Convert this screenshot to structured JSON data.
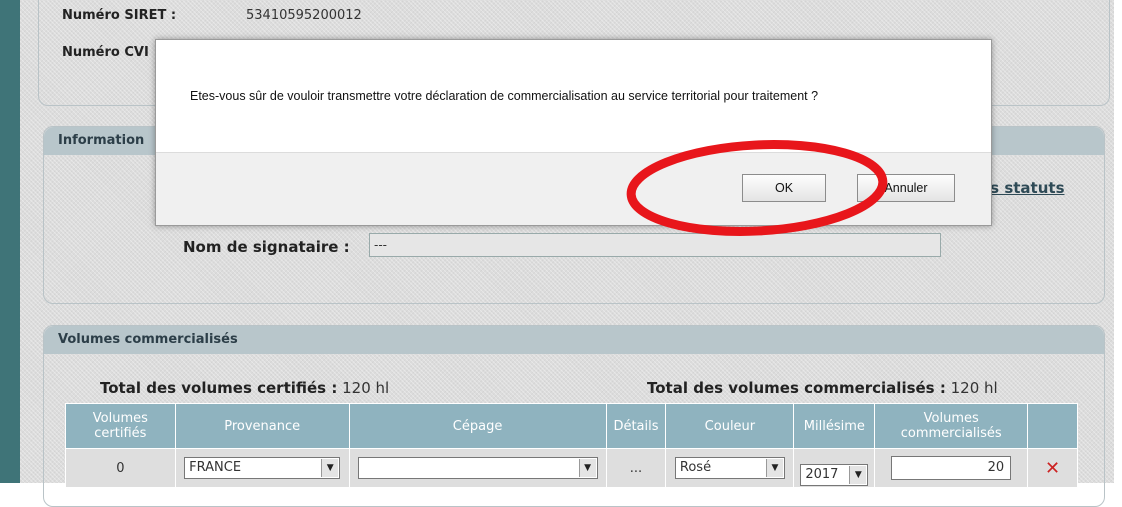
{
  "header_info": {
    "siret_label": "Numéro SIRET :",
    "siret_value": "53410595200012",
    "cvi_label": "Numéro CVI"
  },
  "information_panel": {
    "title": "Information",
    "statuts_link": "es statuts",
    "signatory_label": "Nom de signataire :",
    "signatory_value": "---"
  },
  "volumes_panel": {
    "title": "Volumes commercialisés",
    "total_certified_label": "Total des volumes certifiés :",
    "total_certified_value": "120 hl",
    "total_marketed_label": "Total des volumes commercialisés :",
    "total_marketed_value": "120 hl",
    "columns": [
      "Volumes certifiés",
      "Provenance",
      "Cépage",
      "Détails",
      "Couleur",
      "Millésime",
      "Volumes commercialisés"
    ],
    "rows": [
      {
        "certified": "0",
        "provenance": "FRANCE",
        "cepage": "",
        "details": "...",
        "couleur": "Rosé",
        "millesime": "2017",
        "commercialises": "20"
      }
    ]
  },
  "dialog": {
    "message": "Etes-vous sûr de vouloir transmettre votre déclaration de commercialisation au service territorial pour traitement ?",
    "ok_label": "OK",
    "cancel_label": "Annuler"
  },
  "colors": {
    "sidebar": "#3f7478",
    "panel_header": "#b8c6cb",
    "table_header": "#8fb3bf",
    "annotation": "#e8161b",
    "delete": "#cc2222"
  },
  "icons": {
    "delete": "delete-x-icon",
    "dropdown": "dropdown-arrow-icon"
  }
}
